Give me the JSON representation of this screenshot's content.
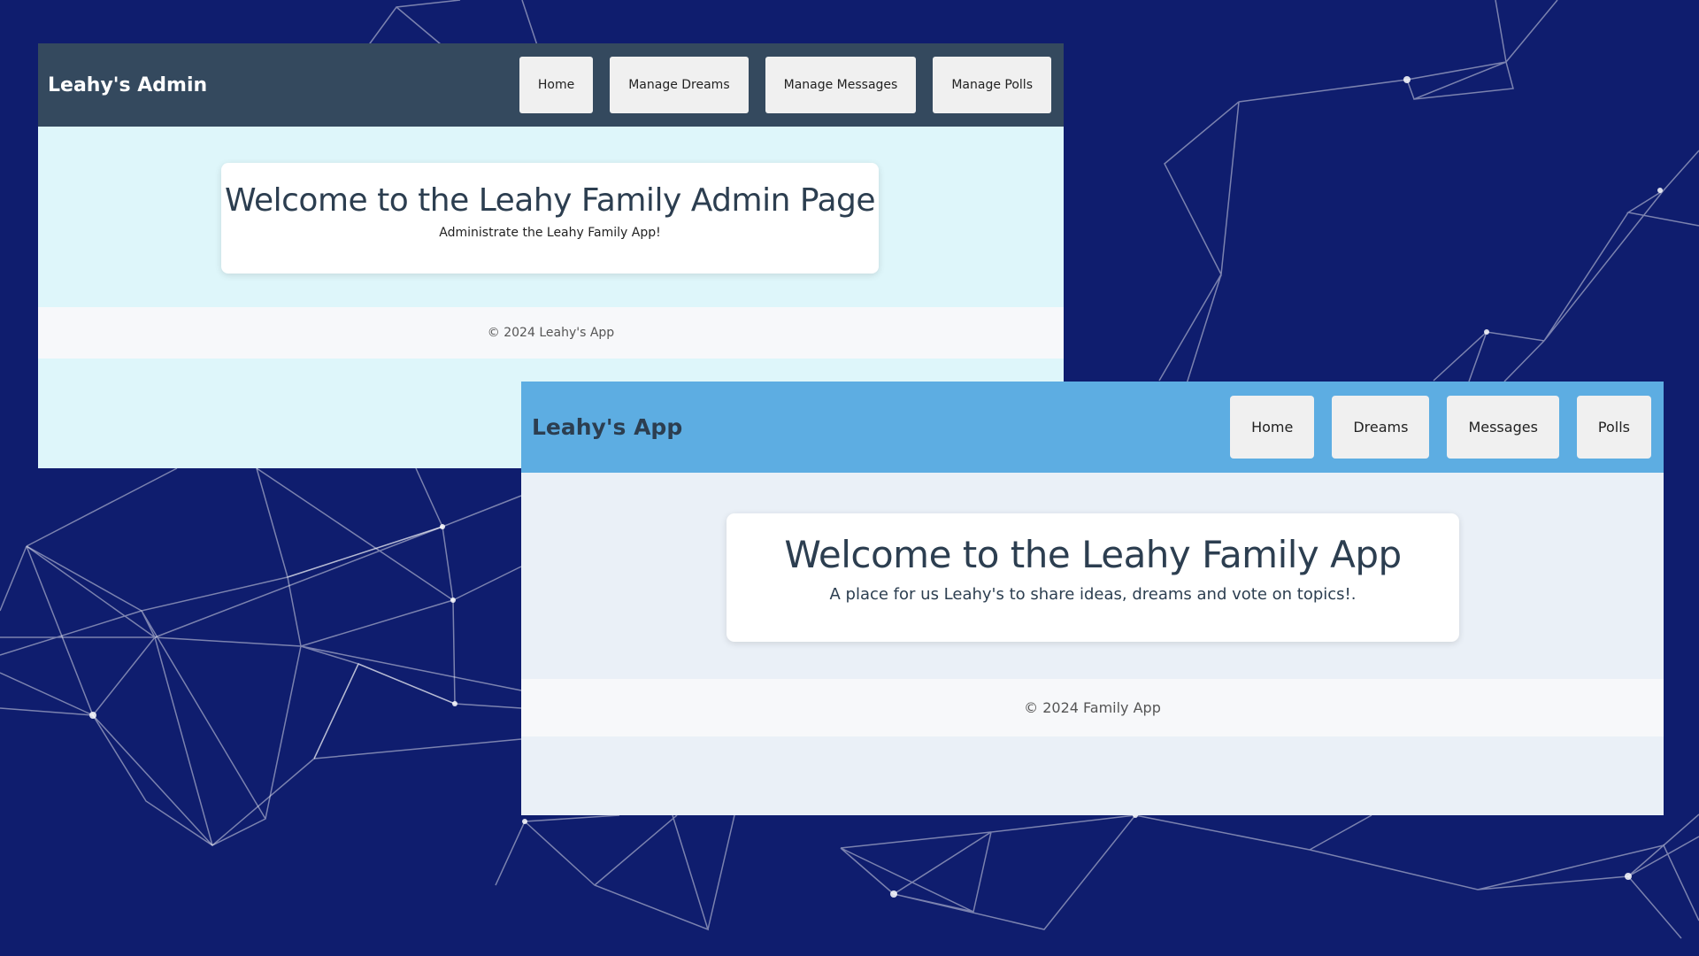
{
  "colors": {
    "background": "#0f1d6e",
    "admin_navbar": "#34495e",
    "admin_body": "#def6fa",
    "app_navbar": "#5dade2",
    "app_body": "#eaf0f7"
  },
  "admin": {
    "brand": "Leahy's Admin",
    "nav": [
      "Home",
      "Manage Dreams",
      "Manage Messages",
      "Manage Polls"
    ],
    "hero_title": "Welcome to the Leahy Family Admin Page",
    "hero_subtitle": "Administrate the Leahy Family App!",
    "footer": "© 2024 Leahy's App"
  },
  "app": {
    "brand": "Leahy's App",
    "nav": [
      "Home",
      "Dreams",
      "Messages",
      "Polls"
    ],
    "hero_title": "Welcome to the Leahy Family App",
    "hero_subtitle": "A place for us Leahy's to share ideas, dreams and vote on topics!.",
    "footer": "© 2024 Family App"
  }
}
